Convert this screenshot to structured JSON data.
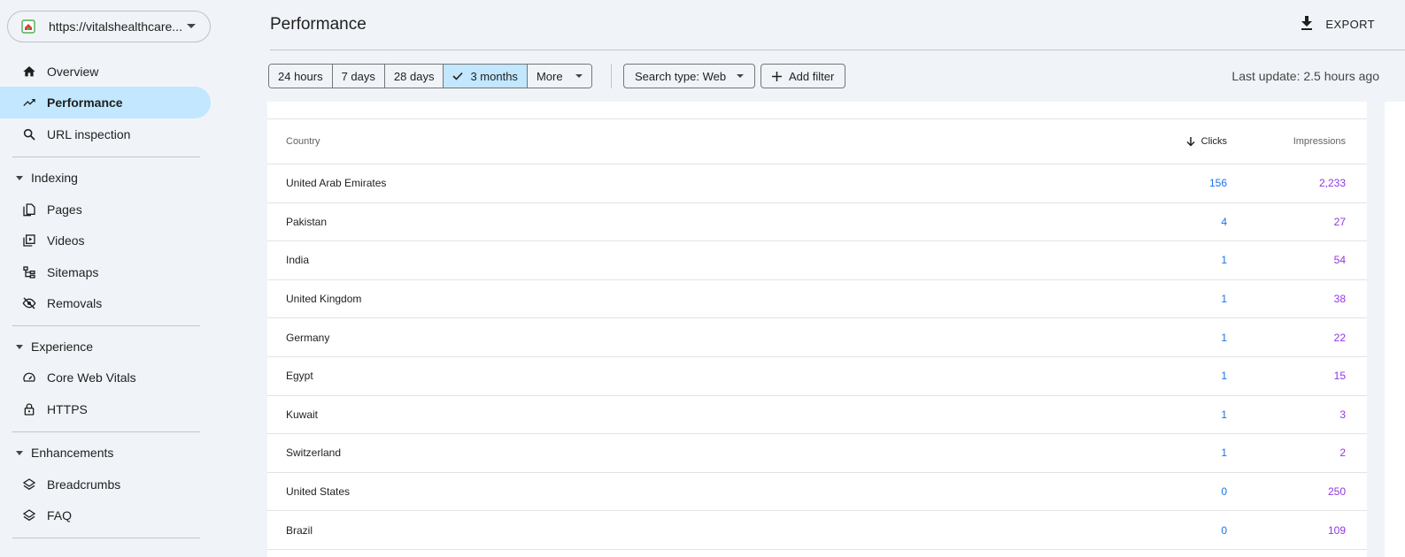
{
  "property": {
    "url": "https://vitalshealthcare...",
    "icon": "site-favicon"
  },
  "sidebar": {
    "top_items": [
      {
        "label": "Overview",
        "icon": "home-icon"
      },
      {
        "label": "Performance",
        "icon": "trending-up-icon",
        "active": true
      },
      {
        "label": "URL inspection",
        "icon": "search-icon"
      }
    ],
    "sections": [
      {
        "title": "Indexing",
        "items": [
          {
            "label": "Pages",
            "icon": "pages-icon"
          },
          {
            "label": "Videos",
            "icon": "video-icon"
          },
          {
            "label": "Sitemaps",
            "icon": "sitemap-icon"
          },
          {
            "label": "Removals",
            "icon": "eye-off-icon"
          }
        ]
      },
      {
        "title": "Experience",
        "items": [
          {
            "label": "Core Web Vitals",
            "icon": "gauge-icon"
          },
          {
            "label": "HTTPS",
            "icon": "lock-icon"
          }
        ]
      },
      {
        "title": "Enhancements",
        "items": [
          {
            "label": "Breadcrumbs",
            "icon": "layers-icon"
          },
          {
            "label": "FAQ",
            "icon": "layers-icon"
          }
        ]
      }
    ]
  },
  "header": {
    "title": "Performance",
    "export_label": "EXPORT"
  },
  "toolbar": {
    "date_ranges": [
      "24 hours",
      "7 days",
      "28 days",
      "3 months"
    ],
    "selected_range": "3 months",
    "more_label": "More",
    "search_type": "Search type: Web",
    "add_filter": "Add filter",
    "last_update": "Last update: 2.5 hours ago"
  },
  "table": {
    "columns": {
      "country": "Country",
      "clicks": "Clicks",
      "impressions": "Impressions"
    },
    "rows": [
      {
        "country": "United Arab Emirates",
        "clicks": "156",
        "impressions": "2,233"
      },
      {
        "country": "Pakistan",
        "clicks": "4",
        "impressions": "27"
      },
      {
        "country": "India",
        "clicks": "1",
        "impressions": "54"
      },
      {
        "country": "United Kingdom",
        "clicks": "1",
        "impressions": "38"
      },
      {
        "country": "Germany",
        "clicks": "1",
        "impressions": "22"
      },
      {
        "country": "Egypt",
        "clicks": "1",
        "impressions": "15"
      },
      {
        "country": "Kuwait",
        "clicks": "1",
        "impressions": "3"
      },
      {
        "country": "Switzerland",
        "clicks": "1",
        "impressions": "2"
      },
      {
        "country": "United States",
        "clicks": "0",
        "impressions": "250"
      },
      {
        "country": "Brazil",
        "clicks": "0",
        "impressions": "109"
      }
    ]
  },
  "colors": {
    "accent": "#c2e7ff",
    "clicks": "#1a73e8",
    "impressions": "#9334e6"
  }
}
